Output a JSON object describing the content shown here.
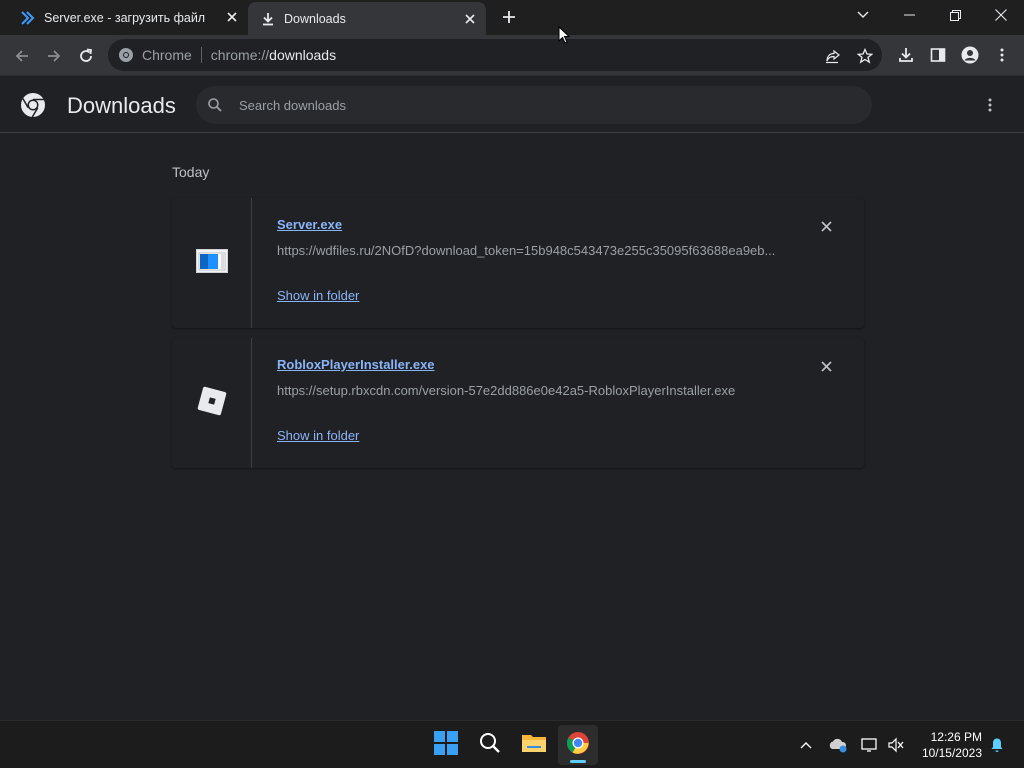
{
  "tabs": [
    {
      "title": "Server.exe - загрузить файл",
      "icon": "double-chevron-icon"
    },
    {
      "title": "Downloads",
      "icon": "download-icon"
    }
  ],
  "toolbar": {
    "site_label": "Chrome",
    "url_prefix": "chrome://",
    "url_path": "downloads"
  },
  "header": {
    "title": "Downloads",
    "search_placeholder": "Search downloads"
  },
  "section": {
    "day_label": "Today"
  },
  "downloads": [
    {
      "name": "Server.exe",
      "url": "https://wdfiles.ru/2NOfD?download_token=15b948c543473e255c35095f63688ea9eb...",
      "action": "Show in folder",
      "icon": "exe-file-icon"
    },
    {
      "name": "RobloxPlayerInstaller.exe",
      "url": "https://setup.rbxcdn.com/version-57e2dd886e0e42a5-RobloxPlayerInstaller.exe",
      "action": "Show in folder",
      "icon": "roblox-icon"
    }
  ],
  "taskbar": {
    "time": "12:26 PM",
    "date": "10/15/2023"
  },
  "colors": {
    "accent_link": "#8ab4f8",
    "background": "#202124",
    "toolbar": "#35363a"
  }
}
